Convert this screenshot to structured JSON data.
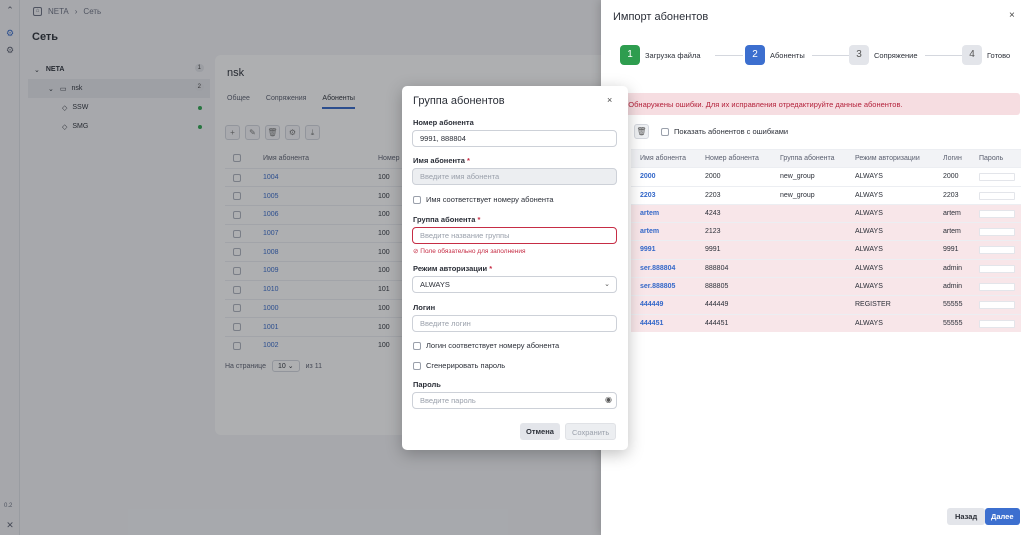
{
  "breadcrumb": {
    "root": "NETA",
    "current": "Сеть"
  },
  "page_title": "Сеть",
  "sidebar": {
    "version": "0.2"
  },
  "tree": [
    {
      "label": "NETA",
      "count": "1",
      "level": 0
    },
    {
      "label": "nsk",
      "count": "2",
      "level": 1
    },
    {
      "label": "SSW",
      "level": 2
    },
    {
      "label": "SMG",
      "level": 2
    }
  ],
  "node": {
    "title": "nsk",
    "tabs": [
      "Общее",
      "Сопряжения",
      "Абоненты"
    ],
    "list_headers": [
      "Имя абонента",
      "Номер"
    ],
    "list_rows": [
      [
        "1004",
        "100"
      ],
      [
        "1005",
        "100"
      ],
      [
        "1006",
        "100"
      ],
      [
        "1007",
        "100"
      ],
      [
        "1008",
        "100"
      ],
      [
        "1009",
        "100"
      ],
      [
        "1010",
        "101"
      ],
      [
        "1000",
        "100"
      ],
      [
        "1001",
        "100"
      ],
      [
        "1002",
        "100"
      ]
    ],
    "pager": {
      "label": "На странице",
      "value": "10",
      "total": "из 11"
    }
  },
  "import": {
    "title": "Импорт абонентов",
    "close": "×",
    "steps": [
      {
        "num": "1",
        "label": "Загрузка файла",
        "color": "#2e9d4f"
      },
      {
        "num": "2",
        "label": "Абоненты",
        "color": "#3c6fcf"
      },
      {
        "num": "3",
        "label": "Сопряжение",
        "color": "#e3e5ea"
      },
      {
        "num": "4",
        "label": "Готово",
        "color": "#e3e5ea"
      }
    ],
    "error_text": "Обнаружены ошибки. Для их исправления отредактируйте данные абонентов.",
    "show_errors_label": "Показать абонентов с ошибками",
    "table_headers": [
      "Имя абонента",
      "Номер абонента",
      "Группа абонента",
      "Режим авторизации",
      "Логин",
      "Пароль"
    ],
    "rows": [
      {
        "name": "2000",
        "number": "2000",
        "group": "new_group",
        "auth": "ALWAYS",
        "login": "2000",
        "bad": false
      },
      {
        "name": "2203",
        "number": "2203",
        "group": "new_group",
        "auth": "ALWAYS",
        "login": "2203",
        "bad": false
      },
      {
        "name": "artem",
        "number": "4243",
        "group": "",
        "auth": "ALWAYS",
        "login": "artem",
        "bad": true
      },
      {
        "name": "artem",
        "number": "2123",
        "group": "",
        "auth": "ALWAYS",
        "login": "artem",
        "bad": true
      },
      {
        "name": "9991",
        "number": "9991",
        "group": "",
        "auth": "ALWAYS",
        "login": "9991",
        "bad": true
      },
      {
        "name": "ser.888804",
        "number": "888804",
        "group": "",
        "auth": "ALWAYS",
        "login": "admin",
        "bad": true
      },
      {
        "name": "ser.888805",
        "number": "888805",
        "group": "",
        "auth": "ALWAYS",
        "login": "admin",
        "bad": true
      },
      {
        "name": "444449",
        "number": "444449",
        "group": "",
        "auth": "REGISTER",
        "login": "55555",
        "bad": true
      },
      {
        "name": "444451",
        "number": "444451",
        "group": "",
        "auth": "ALWAYS",
        "login": "55555",
        "bad": true
      }
    ],
    "back_label": "Назад",
    "next_label": "Далее"
  },
  "modal": {
    "title": "Группа абонентов",
    "close": "×",
    "number_label": "Номер абонента",
    "number_value": "9991, 888804",
    "name_label": "Имя абонента",
    "name_placeholder": "Введите имя абонента",
    "name_matches_label": "Имя соответствует номеру абонента",
    "group_label": "Группа абонента",
    "group_placeholder": "Введите название группы",
    "group_error": "Поле обязательно для заполнения",
    "auth_label": "Режим авторизации",
    "auth_value": "ALWAYS",
    "login_label": "Логин",
    "login_placeholder": "Введите логин",
    "login_matches_label": "Логин соответствует номеру абонента",
    "generate_password_label": "Сгенерировать пароль",
    "password_label": "Пароль",
    "password_placeholder": "Введите пароль",
    "cancel_label": "Отмена",
    "save_label": "Сохранить",
    "required_mark": "*"
  }
}
